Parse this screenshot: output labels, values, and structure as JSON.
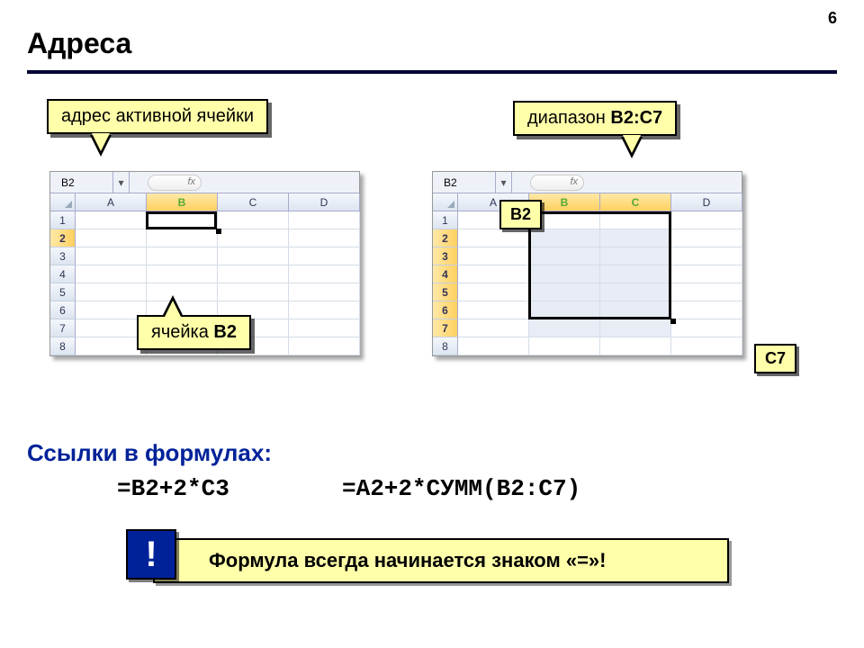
{
  "page_number": "6",
  "title": "Адреса",
  "callouts": {
    "active_cell_addr": "адрес активной ячейки",
    "cell_label_prefix": "ячейка ",
    "cell_label_bold": "B2",
    "range_label_prefix": "диапазон ",
    "range_label_bold": "B2:C7",
    "b2": "B2",
    "c7": "C7"
  },
  "sheet": {
    "name_box": "B2",
    "fx": "fx",
    "columns": [
      "A",
      "B",
      "C",
      "D"
    ],
    "rows": [
      "1",
      "2",
      "3",
      "4",
      "5",
      "6",
      "7",
      "8"
    ]
  },
  "links_heading": "Ссылки в формулах:",
  "formula1": "=B2+2*C3",
  "formula2": "=A2+2*СУММ(B2:C7)",
  "bang": "!",
  "note": "Формула всегда начинается знаком «=»!"
}
